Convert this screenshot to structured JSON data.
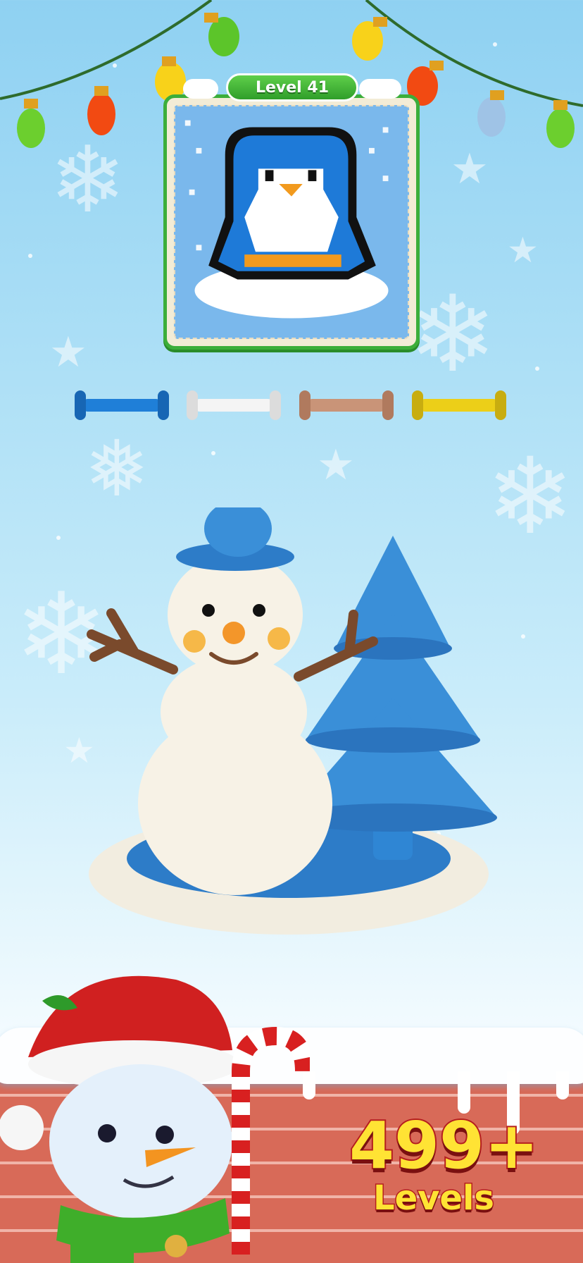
{
  "game": {
    "level_label": "Level 41",
    "levels_count": "499+",
    "levels_label": "Levels"
  },
  "spools": [
    {
      "color_name": "blue",
      "color": "#1f7fd8"
    },
    {
      "color_name": "white",
      "color": "#f4f4f4"
    },
    {
      "color_name": "tan",
      "color": "#c99478"
    },
    {
      "color_name": "yellow",
      "color": "#eccf18"
    }
  ],
  "palette": {
    "frame_green": "#3cae3a",
    "brick": "#d86a58",
    "title_yellow": "#ffe334",
    "title_outline": "#b51e1e"
  }
}
